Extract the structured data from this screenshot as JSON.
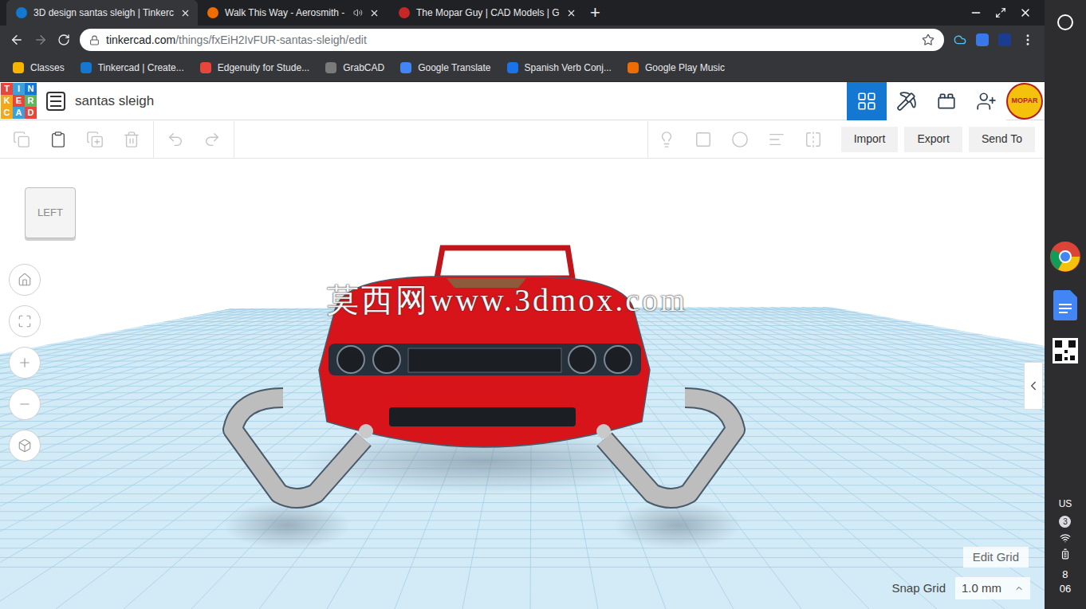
{
  "browser": {
    "tabs": [
      {
        "title": "3D design santas sleigh | Tinkerc",
        "selected": true,
        "audio": false,
        "color": "#1477d1"
      },
      {
        "title": "Walk This Way - Aerosmith -",
        "selected": false,
        "audio": true,
        "color": "#ef6c00"
      },
      {
        "title": "The Mopar Guy | CAD Models | G",
        "selected": false,
        "audio": false,
        "color": "#c62828"
      }
    ],
    "new_tab": "+",
    "address": {
      "host": "tinkercad.com",
      "path": "/things/fxEiH2IvFUR-santas-sleigh/edit"
    },
    "bookmarks": [
      {
        "label": "Classes",
        "color": "#f4b400"
      },
      {
        "label": "Tinkercad | Create...",
        "color": "#1477d1"
      },
      {
        "label": "Edgenuity for Stude...",
        "color": "#e8453c"
      },
      {
        "label": "GrabCAD",
        "color": "#7a7a7a"
      },
      {
        "label": "Google Translate",
        "color": "#4285f4"
      },
      {
        "label": "Spanish Verb Conj...",
        "color": "#1a73e8"
      },
      {
        "label": "Google Play Music",
        "color": "#ef6c00"
      }
    ]
  },
  "app": {
    "logo": [
      {
        "letter": "T",
        "color": "#e8453c"
      },
      {
        "letter": "I",
        "color": "#3aa1dd"
      },
      {
        "letter": "N",
        "color": "#1477d1"
      },
      {
        "letter": "K",
        "color": "#f2a71c"
      },
      {
        "letter": "E",
        "color": "#e8453c"
      },
      {
        "letter": "R",
        "color": "#5cb85c"
      },
      {
        "letter": "C",
        "color": "#f2a71c"
      },
      {
        "letter": "A",
        "color": "#3aa1dd"
      },
      {
        "letter": "D",
        "color": "#e8453c"
      }
    ],
    "title": "santas sleigh",
    "avatar": "MOPAR",
    "nav": [
      {
        "name": "3d-design",
        "selected": true
      },
      {
        "name": "codeblocks",
        "selected": false
      },
      {
        "name": "bricks",
        "selected": false
      },
      {
        "name": "share",
        "selected": false
      }
    ]
  },
  "toolbar": {
    "buttons": [
      "Import",
      "Export",
      "Send To"
    ]
  },
  "viewport": {
    "view_cube": "LEFT",
    "watermark": "莫西网www.3dmox.com",
    "edit_grid": "Edit Grid",
    "snap_grid": {
      "label": "Snap Grid",
      "value": "1.0 mm"
    }
  },
  "shelf": {
    "keyboard": "US",
    "notifications": "3",
    "time": [
      "8",
      "06"
    ]
  }
}
